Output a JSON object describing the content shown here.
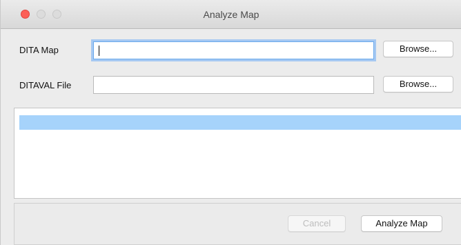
{
  "window": {
    "title": "Analyze Map"
  },
  "form": {
    "dita_map": {
      "label": "DITA Map",
      "value": "",
      "browse_label": "Browse..."
    },
    "ditaval": {
      "label": "DITAVAL File",
      "value": "",
      "browse_label": "Browse..."
    }
  },
  "results": {
    "items": [
      ""
    ]
  },
  "actions": {
    "cancel_label": "Cancel",
    "analyze_label": "Analyze Map"
  },
  "colors": {
    "selection": "#a6d3fb",
    "focus_ring": "#a5c8f2",
    "close_button": "#fc5f57"
  }
}
